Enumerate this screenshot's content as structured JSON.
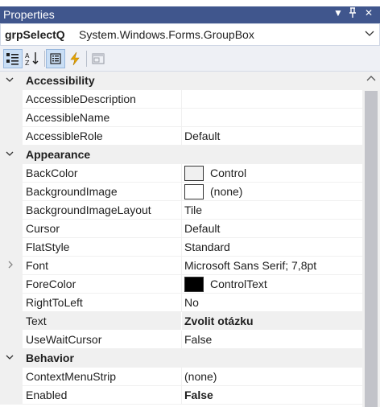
{
  "window": {
    "title": "Properties"
  },
  "object_selector": {
    "name": "grpSelectQ",
    "type": "System.Windows.Forms.GroupBox"
  },
  "toolbar": {
    "buttons": [
      "categorized-icon",
      "alphabetical-icon",
      "properties-icon",
      "events-icon",
      "property-pages-icon"
    ]
  },
  "colors": {
    "titlebar": "#40568d",
    "backcolor_swatch": "#f0f0f0",
    "forecolor_swatch": "#000000"
  },
  "grid": {
    "categories": {
      "accessibility": "Accessibility",
      "appearance": "Appearance",
      "behavior": "Behavior"
    },
    "rows": {
      "accessible_description": {
        "name": "AccessibleDescription",
        "value": ""
      },
      "accessible_name": {
        "name": "AccessibleName",
        "value": ""
      },
      "accessible_role": {
        "name": "AccessibleRole",
        "value": "Default"
      },
      "back_color": {
        "name": "BackColor",
        "value": "Control"
      },
      "background_image": {
        "name": "BackgroundImage",
        "value": "(none)"
      },
      "background_image_layout": {
        "name": "BackgroundImageLayout",
        "value": "Tile"
      },
      "cursor": {
        "name": "Cursor",
        "value": "Default"
      },
      "flat_style": {
        "name": "FlatStyle",
        "value": "Standard"
      },
      "font": {
        "name": "Font",
        "value": "Microsoft Sans Serif; 7,8pt"
      },
      "fore_color": {
        "name": "ForeColor",
        "value": "ControlText"
      },
      "right_to_left": {
        "name": "RightToLeft",
        "value": "No"
      },
      "text": {
        "name": "Text",
        "value": "Zvolit otázku"
      },
      "use_wait_cursor": {
        "name": "UseWaitCursor",
        "value": "False"
      },
      "context_menu_strip": {
        "name": "ContextMenuStrip",
        "value": "(none)"
      },
      "enabled": {
        "name": "Enabled",
        "value": "False"
      }
    }
  }
}
